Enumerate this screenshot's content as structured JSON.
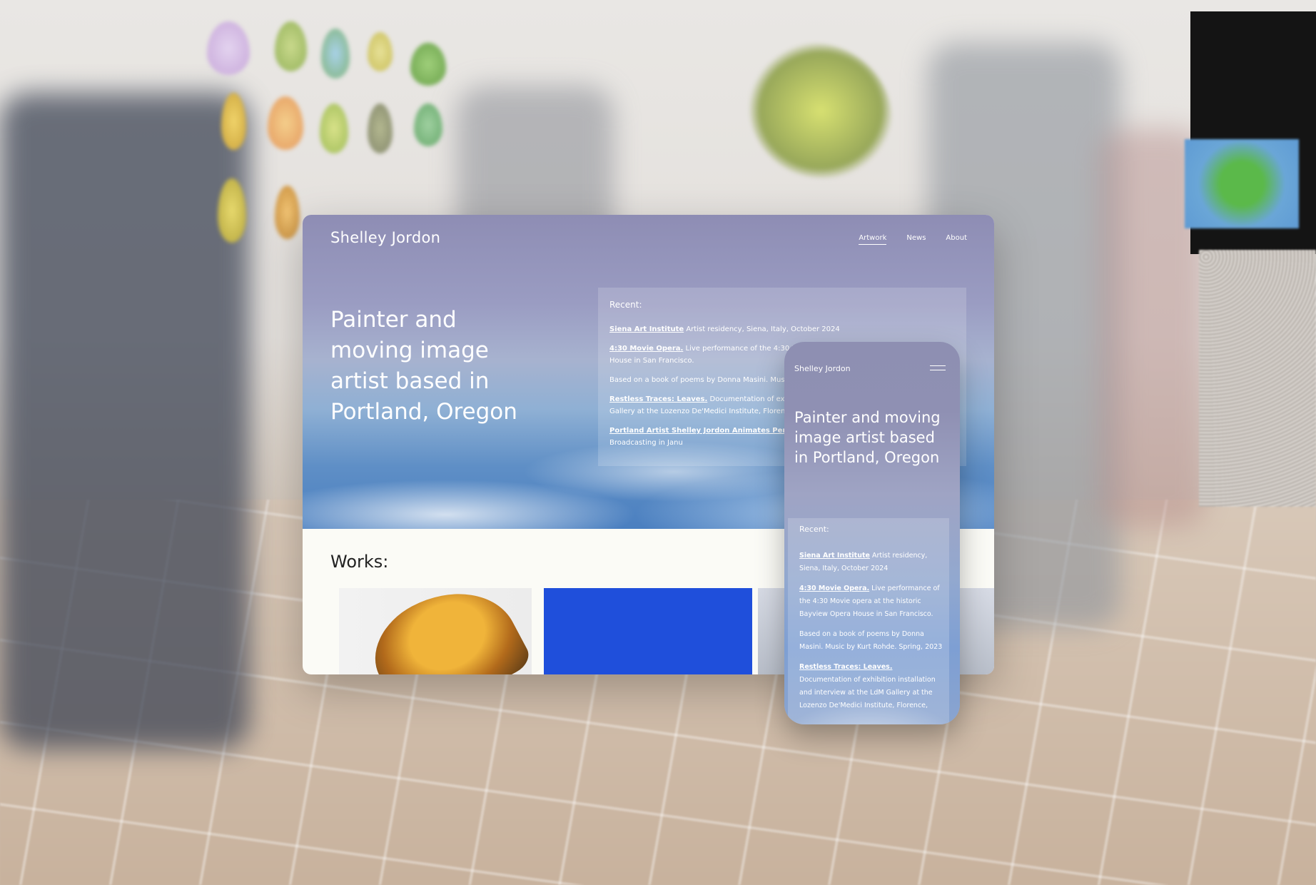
{
  "desktop": {
    "brand": "Shelley Jordon",
    "nav": [
      "Artwork",
      "News",
      "About"
    ],
    "active_nav": "Artwork",
    "headline": "Painter and moving image artist based in Portland, Oregon",
    "recent_title": "Recent:",
    "recent_items": [
      {
        "link": "Siena Art Institute",
        "text": " Artist residency, Siena, Italy, October 2024"
      },
      {
        "link": "4:30 Movie Opera.",
        "text": " Live performance of the 4:30 Movie opera at the historic Bayview Opera House in San Francisco."
      },
      {
        "link": "",
        "text": "Based on a book of poems by Donna Masini. Music by Kurt Rohde. Spring, 2023"
      },
      {
        "link": "Restless Traces: Leaves.",
        "text": " Documentation of exhibition installation and interview at the LdM Gallery at the Lozenzo De'Medici Institute, Florence, Italy, fa"
      },
      {
        "link": "Portland Artist Shelley Jordon Animates Persona",
        "text": " that aired on Oregon Public Broadcasting in Janu"
      }
    ],
    "works_title": "Works:"
  },
  "phone": {
    "brand": "Shelley Jordon",
    "headline": "Painter and moving image artist based in Portland, Oregon",
    "recent_title": "Recent:",
    "recent_items": [
      {
        "link": "Siena Art Institute",
        "text": " Artist residency, Siena, Italy, October 2024"
      },
      {
        "link": "4:30 Movie Opera.",
        "text": " Live performance of the 4:30 Movie opera at the historic Bayview Opera House in San Francisco."
      },
      {
        "link": "",
        "text": "Based on a book of poems by Donna Masini. Music by Kurt Rohde. Spring, 2023"
      },
      {
        "link": "Restless Traces: Leaves.",
        "text": " Documentation of exhibition installation and interview at the LdM Gallery at the Lozenzo De'Medici Institute, Florence,"
      }
    ]
  },
  "colors": {
    "hero_top": "#8e8db4",
    "hero_bottom": "#4a7fc0",
    "works_bg": "#fbfbf6",
    "thumb_blue": "#1f4fdb"
  }
}
